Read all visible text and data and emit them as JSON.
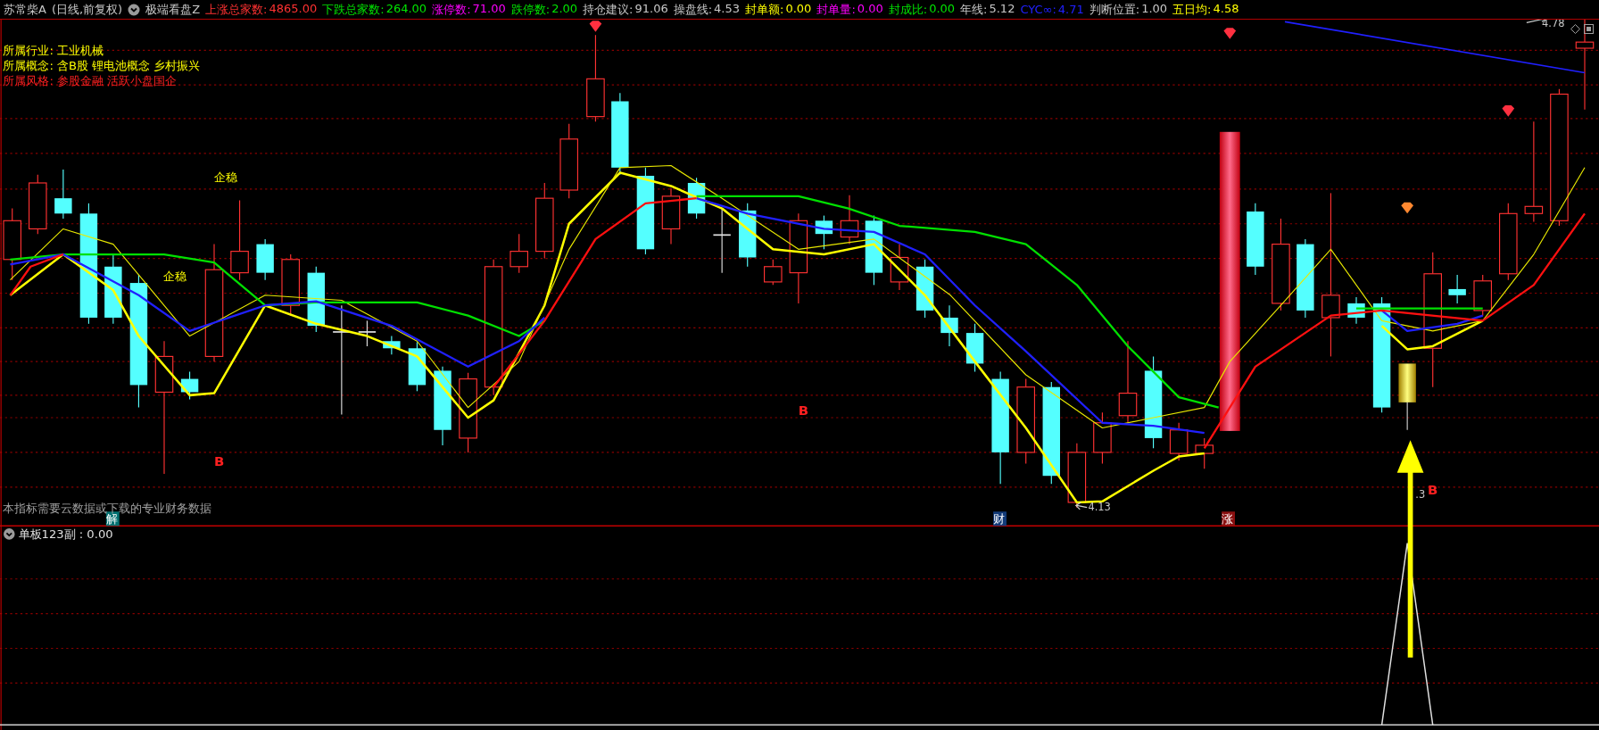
{
  "header": {
    "stock": "苏常柴A",
    "period": "(日线,前复权)",
    "indicator": "极端看盘Z",
    "stats": [
      {
        "label": "上涨总家数:",
        "value": "4865.00",
        "color": "#ff3232"
      },
      {
        "label": "下跌总家数:",
        "value": "264.00",
        "color": "#00e600"
      },
      {
        "label": "涨停数:",
        "value": "71.00",
        "color": "#ff00ff"
      },
      {
        "label": "跌停数:",
        "value": "2.00",
        "color": "#00e600"
      },
      {
        "label": "持仓建议:",
        "value": "91.06",
        "color": "#c8c8c8"
      },
      {
        "label": "操盘线:",
        "value": "4.53",
        "color": "#c8c8c8"
      },
      {
        "label": "封单额:",
        "value": "0.00",
        "color": "#ffff00"
      },
      {
        "label": "封单量:",
        "value": "0.00",
        "color": "#ff00ff"
      },
      {
        "label": "封成比:",
        "value": "0.00",
        "color": "#00e600"
      },
      {
        "label": "年线:",
        "value": "5.12",
        "color": "#c8c8c8"
      },
      {
        "label": "CYC∞:",
        "value": "4.71",
        "color": "#2020ff"
      },
      {
        "label": "判断位置:",
        "value": "1.00",
        "color": "#c8c8c8"
      },
      {
        "label": "五日均:",
        "value": "4.58",
        "color": "#ffff00"
      }
    ]
  },
  "info_lines": [
    {
      "label": "所属行业:",
      "value": "工业机械",
      "color": "#ffff00"
    },
    {
      "label": "所属概念:",
      "value": "含B股 锂电池概念 乡村振兴",
      "color": "#ffff00"
    },
    {
      "label": "所属风格:",
      "value": "参股金融 活跃小盘国企",
      "color": "#ff2020"
    }
  ],
  "chart": {
    "labels": [
      {
        "text": "企稳",
        "kind": "signal"
      },
      {
        "text": "企稳",
        "kind": "signal"
      },
      {
        "text": "B",
        "kind": "buy"
      },
      {
        "text": "B",
        "kind": "buy"
      },
      {
        "text": "B",
        "kind": "buy"
      },
      {
        "text": "4.78",
        "kind": "price"
      },
      {
        "text": "4.13",
        "kind": "price"
      },
      {
        "text": ".3",
        "kind": "price"
      }
    ],
    "badges": [
      {
        "text": "解",
        "color": "#007070"
      },
      {
        "text": "财",
        "color": "#123a78"
      },
      {
        "text": "涨",
        "color": "#8a1010"
      }
    ],
    "note": "本指标需要云数据或下载的专业财务数据"
  },
  "sub_panel": {
    "title": "单板123副 : 0.00"
  }
}
